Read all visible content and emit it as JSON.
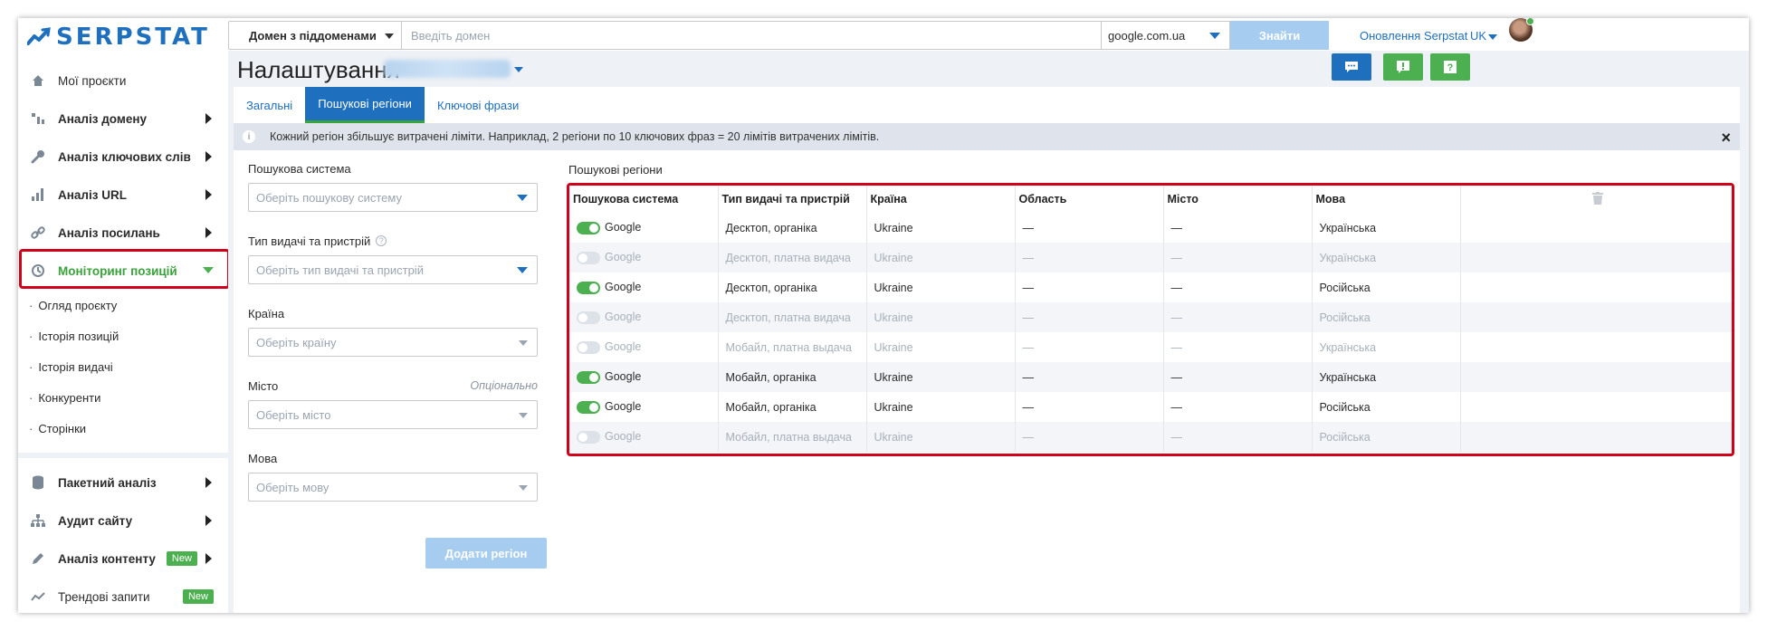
{
  "brand": {
    "name": "SERPSTAT",
    "primary": "#1f6fbf",
    "accent": "#4caf50",
    "highlight": "#d0021b"
  },
  "sidebar": {
    "items": [
      {
        "label": "Мої проєкти",
        "icon": "home-icon"
      },
      {
        "label": "Аналіз домену",
        "icon": "domain-analysis-icon"
      },
      {
        "label": "Аналіз ключових слів",
        "icon": "key-icon"
      },
      {
        "label": "Аналіз URL",
        "icon": "bar-chart-icon"
      },
      {
        "label": "Аналіз посилань",
        "icon": "link-icon"
      },
      {
        "label": "Моніторинг позицій",
        "icon": "history-icon"
      }
    ],
    "subitems": [
      {
        "label": "Огляд проєкту"
      },
      {
        "label": "Історія позицій"
      },
      {
        "label": "Історія видачі"
      },
      {
        "label": "Конкуренти"
      },
      {
        "label": "Сторінки"
      }
    ],
    "bottom_items": [
      {
        "label": "Пакетний аналіз",
        "icon": "database-icon"
      },
      {
        "label": "Аудит сайту",
        "icon": "sitemap-icon"
      },
      {
        "label": "Аналіз контенту",
        "icon": "pencil-icon",
        "badge": "New"
      },
      {
        "label": "Трендові запити",
        "icon": "trend-icon",
        "badge": "New"
      }
    ]
  },
  "topbar": {
    "domain_mode": "Домен з піддоменами",
    "domain_placeholder": "Введіть домен",
    "search_engine": "google.com.ua",
    "find_label": "Знайти",
    "updates_label": "Оновлення Serpstat",
    "lang": "UK"
  },
  "page": {
    "title": "Налаштування",
    "tabs": [
      {
        "label": "Загальні"
      },
      {
        "label": "Пошукові регіони"
      },
      {
        "label": "Ключові фрази"
      }
    ],
    "info": "Кожний регіон збільшує витрачені ліміти. Наприклад, 2 регіони по 10 ключових фраз = 20 лімітів витрачених лімітів.",
    "close": "×"
  },
  "form": {
    "engine_label": "Пошукова система",
    "engine_placeholder": "Оберіть пошукову систему",
    "type_label": "Тип видачі та пристрій",
    "type_placeholder": "Оберіть тип видачі та пристрій",
    "country_label": "Країна",
    "country_placeholder": "Оберіть країну",
    "city_label": "Місто",
    "city_optional": "Опціонально",
    "city_placeholder": "Оберіть місто",
    "lang_label": "Мова",
    "lang_placeholder": "Оберіть мову",
    "add_label": "Додати регіон"
  },
  "regions": {
    "title": "Пошукові регіони",
    "columns": [
      "Пошукова система",
      "Тип видачі та пристрій",
      "Країна",
      "Область",
      "Місто",
      "Мова"
    ],
    "rows": [
      {
        "enabled": true,
        "engine": "Google",
        "type": "Десктоп, органіка",
        "country": "Ukraine",
        "region": "—",
        "city": "—",
        "lang": "Українська"
      },
      {
        "enabled": false,
        "engine": "Google",
        "type": "Десктоп, платна видача",
        "country": "Ukraine",
        "region": "—",
        "city": "—",
        "lang": "Українська"
      },
      {
        "enabled": true,
        "engine": "Google",
        "type": "Десктоп, органіка",
        "country": "Ukraine",
        "region": "—",
        "city": "—",
        "lang": "Російська"
      },
      {
        "enabled": false,
        "engine": "Google",
        "type": "Десктоп, платна видача",
        "country": "Ukraine",
        "region": "—",
        "city": "—",
        "lang": "Російська"
      },
      {
        "enabled": false,
        "engine": "Google",
        "type": "Мобайл, платна выдача",
        "country": "Ukraine",
        "region": "—",
        "city": "—",
        "lang": "Українська"
      },
      {
        "enabled": true,
        "engine": "Google",
        "type": "Мобайл, органіка",
        "country": "Ukraine",
        "region": "—",
        "city": "—",
        "lang": "Українська"
      },
      {
        "enabled": true,
        "engine": "Google",
        "type": "Мобайл, органіка",
        "country": "Ukraine",
        "region": "—",
        "city": "—",
        "lang": "Російська"
      },
      {
        "enabled": false,
        "engine": "Google",
        "type": "Мобайл, платна выдача",
        "country": "Ukraine",
        "region": "—",
        "city": "—",
        "lang": "Російська"
      }
    ]
  }
}
